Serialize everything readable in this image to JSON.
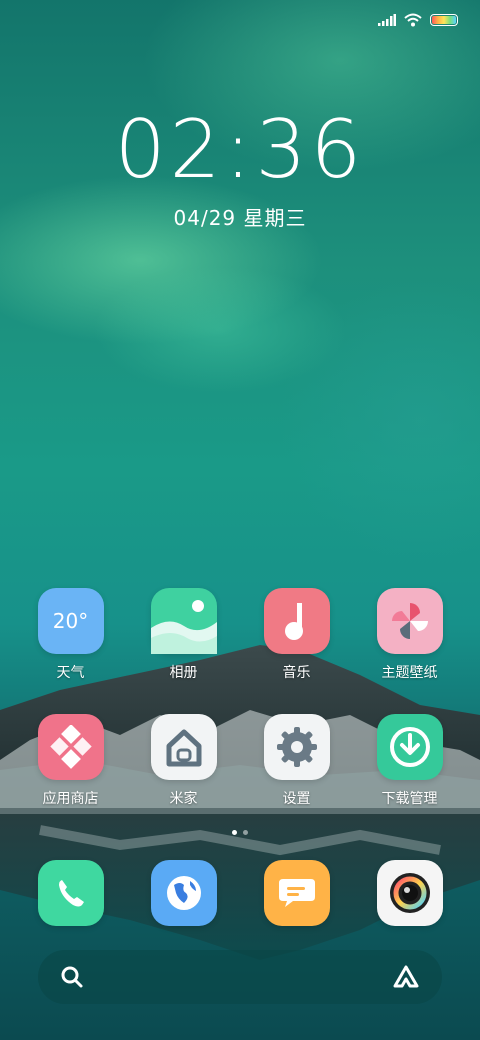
{
  "status_bar": {
    "signal_icon": "signal-bars-icon",
    "wifi_icon": "wifi-icon",
    "battery_icon": "battery-icon"
  },
  "lockclock": {
    "time": "02:36",
    "date": "04/29 星期三"
  },
  "apps": [
    {
      "label": "天气",
      "icon": "weather-icon",
      "color": "#6ab4f5",
      "badge_text": "20°"
    },
    {
      "label": "相册",
      "icon": "gallery-icon",
      "color": "#3fd1a0"
    },
    {
      "label": "音乐",
      "icon": "music-icon",
      "color": "#f07a85"
    },
    {
      "label": "主题壁纸",
      "icon": "themes-icon",
      "color": "#f2a0b8"
    },
    {
      "label": "应用商店",
      "icon": "app-store-icon",
      "color": "#f0738a"
    },
    {
      "label": "米家",
      "icon": "mi-home-icon",
      "color": "#f2f4f5"
    },
    {
      "label": "设置",
      "icon": "settings-gear-icon",
      "color": "#f2f4f5"
    },
    {
      "label": "下载管理",
      "icon": "download-icon",
      "color": "#35c99a"
    }
  ],
  "page_indicator": {
    "pages": 2,
    "active": 1
  },
  "dock": [
    {
      "icon": "phone-icon",
      "color": "#3fd8a0"
    },
    {
      "icon": "browser-globe-icon",
      "color": "#5aaaf5"
    },
    {
      "icon": "messages-icon",
      "color": "#ffb347"
    },
    {
      "icon": "camera-icon",
      "color": "#f5f5f5"
    }
  ],
  "search": {
    "search_icon": "search-icon",
    "assistant_icon": "assistant-icon"
  }
}
